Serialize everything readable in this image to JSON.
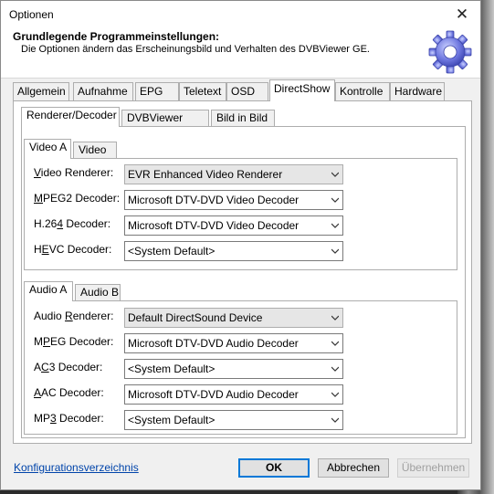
{
  "window": {
    "title": "Optionen",
    "close_glyph": "✕"
  },
  "header": {
    "title": "Grundlegende Programmeinstellungen:",
    "subtitle": "Die Optionen ändern das Erscheinungsbild und Verhalten des DVBViewer GE.",
    "icon": "gear-icon"
  },
  "tabs": [
    "Allgemein",
    "Aufnahme",
    "EPG",
    "Teletext",
    "OSD",
    "DirectShow",
    "Kontrolle",
    "Hardware"
  ],
  "active_tab": "DirectShow",
  "subtabs": [
    "Renderer/Decoder",
    "DVBViewer Filter",
    "Bild in Bild"
  ],
  "video": {
    "tabs": [
      "Video A",
      "Video B"
    ],
    "rows": [
      {
        "pre": "",
        "ul": "V",
        "post": "ideo Renderer:",
        "value": "EVR Enhanced Video Renderer"
      },
      {
        "pre": "",
        "ul": "M",
        "post": "PEG2 Decoder:",
        "value": "Microsoft DTV-DVD Video Decoder"
      },
      {
        "pre": "H.26",
        "ul": "4",
        "post": " Decoder:",
        "value": "Microsoft DTV-DVD Video Decoder"
      },
      {
        "pre": "H",
        "ul": "E",
        "post": "VC Decoder:",
        "value": "<System Default>"
      }
    ]
  },
  "audio": {
    "tabs": [
      "Audio A",
      "Audio B"
    ],
    "rows": [
      {
        "pre": "Audio ",
        "ul": "R",
        "post": "enderer:",
        "value": "Default DirectSound Device"
      },
      {
        "pre": "M",
        "ul": "P",
        "post": "EG Decoder:",
        "value": "Microsoft DTV-DVD Audio Decoder"
      },
      {
        "pre": "A",
        "ul": "C",
        "post": "3 Decoder:",
        "value": "<System Default>"
      },
      {
        "pre": "",
        "ul": "A",
        "post": "AC Decoder:",
        "value": "Microsoft DTV-DVD Audio Decoder"
      },
      {
        "pre": "MP",
        "ul": "3",
        "post": " Decoder:",
        "value": "<System Default>"
      }
    ]
  },
  "footer": {
    "link": "Konfigurationsverzeichnis",
    "ok": "OK",
    "cancel": "Abbrechen",
    "apply": "Übernehmen"
  }
}
